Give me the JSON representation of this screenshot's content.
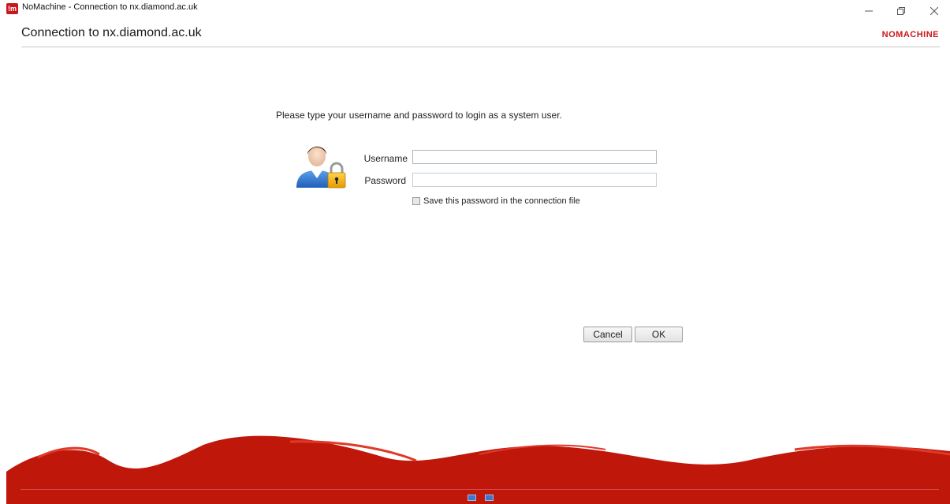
{
  "window": {
    "title": "NoMachine - Connection to nx.diamond.ac.uk",
    "app_icon_text": "!m",
    "controls": [
      "minimize-icon",
      "restore-icon",
      "close-icon"
    ]
  },
  "header": {
    "title": "Connection to nx.diamond.ac.uk",
    "brand": "NOMACHINE"
  },
  "login": {
    "prompt": "Please type your username and password to login as a system user.",
    "avatar_icon": "user-lock-icon",
    "username_label": "Username",
    "username_value": "",
    "password_label": "Password",
    "password_value": "",
    "save_password_label": "Save this password in the connection file",
    "save_password_checked": false
  },
  "buttons": {
    "cancel": "Cancel",
    "ok": "OK"
  },
  "colors": {
    "brand": "#c8181e",
    "footer": "#c0170b"
  }
}
